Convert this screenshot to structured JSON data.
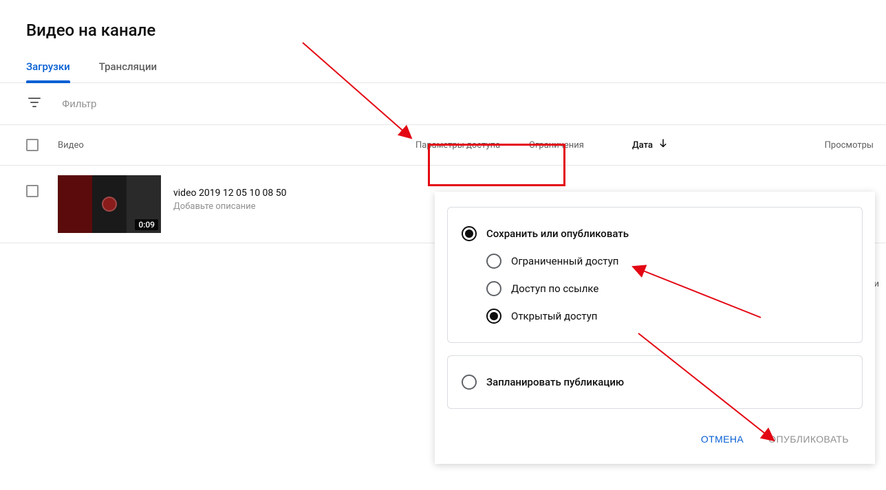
{
  "page": {
    "title": "Видео на канале"
  },
  "tabs": {
    "uploads": "Загрузки",
    "live": "Трансляции"
  },
  "filter": {
    "placeholder": "Фильтр"
  },
  "columns": {
    "video": "Видео",
    "access": "Параметры доступа",
    "restrictions": "Ограничения",
    "date": "Дата",
    "views": "Просмотры"
  },
  "rows": [
    {
      "title": "video 2019 12 05 10 08 50",
      "description_placeholder": "Добавьте описание",
      "duration": "0:09"
    }
  ],
  "misc": {
    "and_more": "и"
  },
  "popup": {
    "save_or_publish": "Сохранить или опубликовать",
    "options": {
      "private": "Ограниченный доступ",
      "unlisted": "Доступ по ссылке",
      "public": "Открытый доступ"
    },
    "schedule": "Запланировать публикацию",
    "actions": {
      "cancel": "ОТМЕНА",
      "publish": "ОПУБЛИКОВАТЬ"
    }
  }
}
